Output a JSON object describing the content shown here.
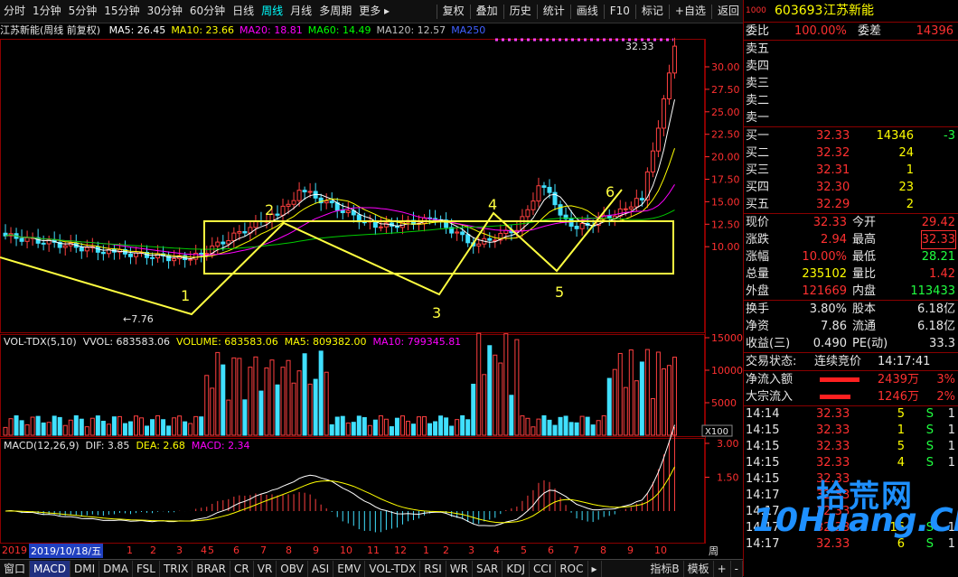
{
  "toolbar": {
    "left": [
      "分时",
      "1分钟",
      "5分钟",
      "15分钟",
      "30分钟",
      "60分钟",
      "日线",
      "周线",
      "月线",
      "多周期",
      "更多 ▸"
    ],
    "active": "周线",
    "right": [
      "复权",
      "叠加",
      "历史",
      "统计",
      "画线",
      "F10",
      "标记",
      "+自选",
      "返回"
    ]
  },
  "info": {
    "title": "江苏新能(周线 前复权)",
    "ma": [
      {
        "text": "MA5: 26.45",
        "color": "#ffffff"
      },
      {
        "text": "MA10: 23.66",
        "color": "#ffff00"
      },
      {
        "text": "MA20: 18.81",
        "color": "#ff00ff"
      },
      {
        "text": "MA60: 14.49",
        "color": "#00ff00"
      },
      {
        "text": "MA120: 12.57",
        "color": "#c0c0c0"
      },
      {
        "text": "MA250",
        "color": "#4060ff"
      }
    ]
  },
  "annotations": {
    "high": "32.33",
    "low": "←7.76",
    "points": [
      "1",
      "2",
      "3",
      "4",
      "5",
      "6"
    ]
  },
  "price_axis": [
    "30.00",
    "27.50",
    "25.00",
    "22.50",
    "20.00",
    "17.50",
    "15.00",
    "12.50",
    "10.00"
  ],
  "vol": {
    "label": "VOL-TDX(5,10)",
    "vvol": "VVOL: 683583.06",
    "volume": "VOLUME: 683583.06",
    "ma5": "MA5: 809382.00",
    "ma10": "MA10: 799345.81",
    "axis": [
      "15000",
      "10000",
      "5000"
    ],
    "unit": "X100"
  },
  "macd": {
    "label": "MACD(12,26,9)",
    "dif": "DIF: 3.85",
    "dea": "DEA: 2.68",
    "macd": "MACD: 2.34",
    "axis": [
      "3.00",
      "1.50"
    ]
  },
  "time_axis": {
    "first": "2019",
    "cursor": "2019/10/18/五",
    "months": [
      "12",
      "1",
      "2",
      "3",
      "4",
      "5",
      "6",
      "7",
      "8",
      "9",
      "10",
      "11",
      "12",
      "1",
      "2",
      "3",
      "4",
      "5",
      "6",
      "7",
      "8",
      "9",
      "10"
    ],
    "period": "周线"
  },
  "tabs": [
    "窗口",
    "MACD",
    "DMI",
    "DMA",
    "FSL",
    "TRIX",
    "BRAR",
    "CR",
    "VR",
    "OBV",
    "ASI",
    "EMV",
    "VOL-TDX",
    "RSI",
    "WR",
    "SAR",
    "KDJ",
    "CCI",
    "ROC",
    "▸",
    "指标B",
    "模板",
    "+",
    "-"
  ],
  "active_tab": "MACD",
  "quote": {
    "code": "603693",
    "name": "江苏新能",
    "weibi_label": "委比",
    "weibi": "100.00%",
    "weicha_label": "委差",
    "weicha": "14396",
    "sell": [
      {
        "label": "卖五"
      },
      {
        "label": "卖四"
      },
      {
        "label": "卖三"
      },
      {
        "label": "卖二"
      },
      {
        "label": "卖一"
      }
    ],
    "buy": [
      {
        "label": "买一",
        "price": "32.33",
        "vol": "14346",
        "chg": "-3"
      },
      {
        "label": "买二",
        "price": "32.32",
        "vol": "24",
        "chg": ""
      },
      {
        "label": "买三",
        "price": "32.31",
        "vol": "1",
        "chg": ""
      },
      {
        "label": "买四",
        "price": "32.30",
        "vol": "23",
        "chg": ""
      },
      {
        "label": "买五",
        "price": "32.29",
        "vol": "2",
        "chg": ""
      }
    ],
    "stats": [
      {
        "l1": "现价",
        "v1": "32.33",
        "c1": "red",
        "l2": "今开",
        "v2": "29.42",
        "c2": "red"
      },
      {
        "l1": "涨跌",
        "v1": "2.94",
        "c1": "red",
        "l2": "最高",
        "v2": "32.33",
        "c2": "red",
        "box": true
      },
      {
        "l1": "涨幅",
        "v1": "10.00%",
        "c1": "red",
        "l2": "最低",
        "v2": "28.21",
        "c2": "green"
      },
      {
        "l1": "总量",
        "v1": "235102",
        "c1": "yellow",
        "l2": "量比",
        "v2": "1.42",
        "c2": "red"
      },
      {
        "l1": "外盘",
        "v1": "121669",
        "c1": "red",
        "l2": "内盘",
        "v2": "113433",
        "c2": "green"
      }
    ],
    "fund": [
      {
        "l1": "换手",
        "v1": "3.80%",
        "l2": "股本",
        "v2": "6.18亿"
      },
      {
        "l1": "净资",
        "v1": "7.86",
        "l2": "流通",
        "v2": "6.18亿"
      },
      {
        "l1": "收益(三)",
        "v1": "0.490",
        "l2": "PE(动)",
        "v2": "33.3"
      }
    ],
    "status_label": "交易状态:",
    "status": "连续竞价",
    "status_time": "14:17:41",
    "flow": [
      {
        "label": "净流入额",
        "value": "2439万",
        "pct": "3%"
      },
      {
        "label": "大宗流入",
        "value": "1246万",
        "pct": "2%"
      }
    ],
    "ticks": [
      {
        "t": "14:14",
        "p": "32.33",
        "v": "5",
        "s": "S",
        "n": "1"
      },
      {
        "t": "14:15",
        "p": "32.33",
        "v": "1",
        "s": "S",
        "n": "1"
      },
      {
        "t": "14:15",
        "p": "32.33",
        "v": "5",
        "s": "S",
        "n": "1"
      },
      {
        "t": "14:15",
        "p": "32.33",
        "v": "4",
        "s": "S",
        "n": "1"
      },
      {
        "t": "14:15",
        "p": "32.33",
        "v": "",
        "s": "",
        "n": ""
      },
      {
        "t": "14:17",
        "p": "32.33",
        "v": "",
        "s": "",
        "n": ""
      },
      {
        "t": "14:17",
        "p": "32.33",
        "v": "",
        "s": "",
        "n": ""
      },
      {
        "t": "14:17",
        "p": "32.33",
        "v": "16",
        "s": "S",
        "n": "1"
      },
      {
        "t": "14:17",
        "p": "32.33",
        "v": "6",
        "s": "S",
        "n": "1"
      }
    ]
  },
  "watermark": {
    "main": "拾荒网",
    "sub": "10Huang.CN"
  }
}
